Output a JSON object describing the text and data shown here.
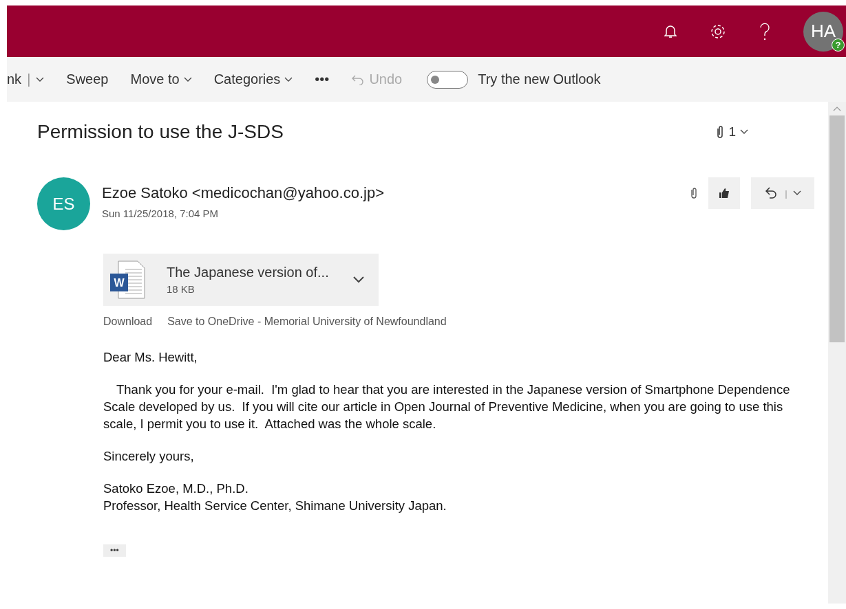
{
  "header": {
    "avatar_initials": "HA",
    "avatar_badge": "?"
  },
  "toolbar": {
    "items": [
      {
        "label": "nk",
        "caret": true,
        "divider": "|"
      },
      {
        "label": "Sweep",
        "caret": false
      },
      {
        "label": "Move to",
        "caret": true
      },
      {
        "label": "Categories",
        "caret": true
      },
      {
        "label": "•••",
        "caret": false
      }
    ],
    "undo": {
      "label": "Undo",
      "disabled": true
    },
    "toggle": {
      "label": "Try the new Outlook",
      "on": false
    }
  },
  "message": {
    "subject": "Permission to use the J-SDS",
    "attachment_count": "1",
    "sender": {
      "initials": "ES",
      "name": "Ezoe Satoko <medicochan@yahoo.co.jp>",
      "date": "Sun 11/25/2018, 7:04 PM"
    },
    "reply_divider": "|",
    "attachment": {
      "icon_letter": "W",
      "name": "The Japanese version of...",
      "size": "18 KB"
    },
    "attachment_actions": [
      "Download",
      "Save to OneDrive - Memorial University of Newfoundland"
    ],
    "body": [
      "Dear Ms. Hewitt,",
      "　Thank you for your e-mail.  I'm glad to hear that you are interested in the Japanese version of Smartphone Dependence Scale developed by us.  If you will cite our article in Open Journal of Preventive Medicine, when you are going to use this scale, I permit you to use it.  Attached was the whole scale.",
      "Sincerely yours,",
      "Satoko Ezoe, M.D., Ph.D.\nProfessor, Health Service Center, Shimane University Japan."
    ],
    "more": "•••"
  }
}
